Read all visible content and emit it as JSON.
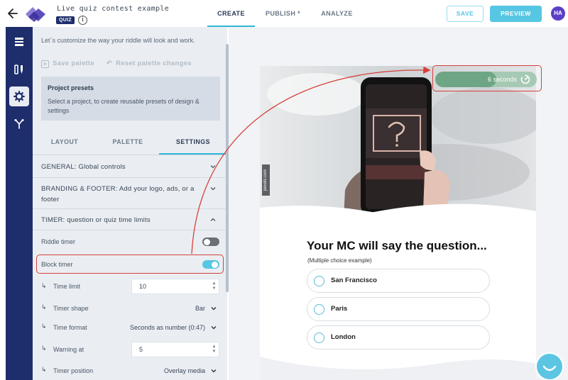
{
  "header": {
    "title": "Live quiz contest example",
    "badge": "QUIZ",
    "info_glyph": "i",
    "tabs": [
      {
        "label": "CREATE"
      },
      {
        "label": "PUBLISH *"
      },
      {
        "label": "ANALYZE"
      }
    ],
    "save_label": "SAVE",
    "preview_label": "PREVIEW",
    "avatar_initials": "HA"
  },
  "rail": {
    "items": [
      {
        "icon": "list-icon"
      },
      {
        "icon": "brush-icon"
      },
      {
        "icon": "gear-icon"
      },
      {
        "icon": "branch-icon"
      }
    ]
  },
  "panel": {
    "intro": "Let`s customize the way your riddle will look and work.",
    "save_palette": "Save palette",
    "reset_palette": "Reset palette changes",
    "presets": {
      "title": "Project presets",
      "description": "Select a project, to create reusable presets of design & settings"
    },
    "tabs": [
      {
        "label": "LAYOUT"
      },
      {
        "label": "PALETTE"
      },
      {
        "label": "SETTINGS"
      }
    ],
    "sections": {
      "general": "GENERAL: Global controls",
      "branding": "BRANDING & FOOTER: Add your logo, ads, or a footer",
      "timer": "TIMER: question or quiz time limits"
    },
    "timer": {
      "riddle_timer_label": "Riddle timer",
      "riddle_timer_on": false,
      "block_timer_label": "Block timer",
      "block_timer_on": true,
      "time_limit_label": "Time limit",
      "time_limit_value": "10",
      "timer_shape_label": "Timer shape",
      "timer_shape_value": "Bar",
      "time_format_label": "Time format",
      "time_format_value": "Seconds as number (0:47)",
      "warning_at_label": "Warning at",
      "warning_at_value": "5",
      "timer_position_label": "Timer position",
      "timer_position_value": "Overlay media",
      "indent_glyph": "↳"
    }
  },
  "preview": {
    "timer_text": "6 seconds",
    "timer_progress": 0.6,
    "photo_credit": "pexels.com",
    "question": "Your MC will say the question...",
    "hint": "(Multiple choice example)",
    "options": [
      {
        "label": "San Francisco"
      },
      {
        "label": "Paris"
      },
      {
        "label": "London"
      }
    ]
  },
  "colors": {
    "rail": "#1e2d6b",
    "accent": "#56c6e3",
    "timer_bar": "#6ea585",
    "highlight": "#d6403a"
  }
}
